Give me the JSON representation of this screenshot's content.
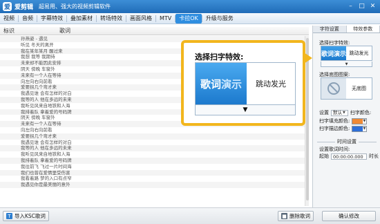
{
  "app": {
    "name": "爱剪辑",
    "slogan": "超易用、强大的视频剪辑软件",
    "logo_char": "爱"
  },
  "window": {
    "min": "–",
    "max": "□",
    "close": "✕"
  },
  "menu": [
    "视频",
    "音频",
    "字幕特效",
    "叠加素材",
    "转场特效",
    "画面风格",
    "MTV",
    "卡拉OK",
    "升级与服务"
  ],
  "menu_active_index": 7,
  "list": {
    "col_mark": "标识",
    "col_lyric": "歌词",
    "rows": [
      "孙燕姿 - 遇见",
      "听见 冬天的离开",
      "我在某年某月 醒过来",
      "我想 我等 我期待",
      "未来却不能因此安排",
      "阴天 傍晚 车窗外",
      "未来有一个人在等待",
      "向左向右向前看",
      "爱要拐几个弯才来",
      "我遇见谁 会有怎样的对白",
      "我等的人 他在多远的未来",
      "我听见风来自地铁和人海",
      "我排着队 拿着爱的号码牌",
      "阴天 傍晚 车窗外",
      "未来有一个人在等待",
      "向左向右向前看",
      "爱要拐几个弯才来",
      "我遇见谁 会有怎样的对白",
      "我等的人 他在多远的未来",
      "我听见风来自地铁和人海",
      "我排着队 拿着爱的号码牌",
      "我往前飞 飞过一片时间海",
      "我们也曾在爱情里受伤害",
      "我看着路 梦的入口有点窄",
      "我遇见你是最美丽的意外"
    ]
  },
  "bottom": {
    "import_label": "导入KSC歌词",
    "delete_label": "删除歌词",
    "confirm_label": "确认修改"
  },
  "panel": {
    "tabs": [
      "字符设置",
      "特效参数"
    ],
    "active_tab": 1,
    "effect_label": "选择扫字特效:",
    "effect_thumb": "歌词演示",
    "effect_name": "跳动发光",
    "bg_label": "选择底图图案:",
    "bg_name": "无底图",
    "setting_label": "设置",
    "setting_value": "默认",
    "text_color_label": "扫字颜色:",
    "fill_color_label": "扫字填充颜色:",
    "fill_color": "#f08a35",
    "stroke_color_label": "扫字描边颜色:",
    "stroke_color": "#2e6fd8",
    "time_header": "时间设置",
    "lyric_time_label": "设置歌词时间:",
    "start_label": "起始",
    "start_value": "00:00:00.000",
    "duration_label": "时长"
  },
  "callout": {
    "title": "选择扫字特效:",
    "thumb_main": "歌词",
    "thumb_hl": "演示",
    "name": "跳动发光"
  },
  "icons": {
    "dropdown": "▼"
  }
}
